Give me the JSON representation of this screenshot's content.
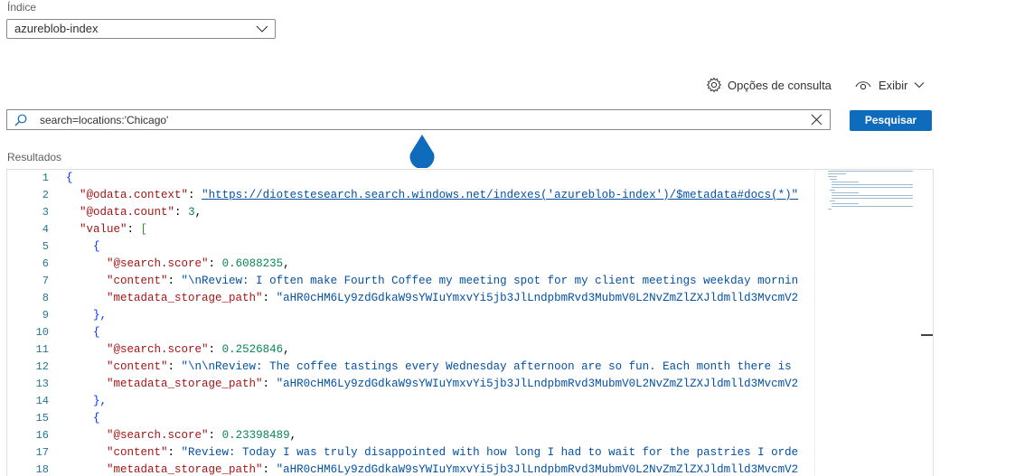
{
  "index": {
    "label": "Índice",
    "selected": "azureblob-index"
  },
  "toolbar": {
    "query_options_label": "Opções de consulta",
    "view_label": "Exibir"
  },
  "search": {
    "value": "search=locations:'Chicago'",
    "button_label": "Pesquisar"
  },
  "results": {
    "label": "Resultados",
    "line_numbers": [
      "1",
      "2",
      "3",
      "4",
      "5",
      "6",
      "7",
      "8",
      "9",
      "10",
      "11",
      "12",
      "13",
      "14",
      "15",
      "16",
      "17",
      "18"
    ],
    "lines": {
      "l1": "{",
      "l2_key": "\"@odata.context\"",
      "l2_val": "\"https://diotestesearch.search.windows.net/indexes('azureblob-index')/$metadata#docs(*)\"",
      "l3_key": "\"@odata.count\"",
      "l3_val": "3",
      "l4_key": "\"value\"",
      "l5": "{",
      "l6_key": "\"@search.score\"",
      "l6_val": "0.6088235",
      "l7_key": "\"content\"",
      "l7_val": "\"\\nReview: I often make Fourth Coffee my meeting spot for my client meetings weekday mornin",
      "l8_key": "\"metadata_storage_path\"",
      "l8_val": "\"aHR0cHM6Ly9zdGdkaW9sYWIuYmxvYi5jb3JlLndpbmRvd3MubmV0L2NvZmZlZXJldmlld3MvcmV2",
      "l9": "},",
      "l10": "{",
      "l11_key": "\"@search.score\"",
      "l11_val": "0.2526846",
      "l12_key": "\"content\"",
      "l12_val": "\"\\n\\nReview: The coffee tastings every Wednesday afternoon are so fun. Each month there is",
      "l13_key": "\"metadata_storage_path\"",
      "l13_val": "\"aHR0cHM6Ly9zdGdkaW9sYWIuYmxvYi5jb3JlLndpbmRvd3MubmV0L2NvZmZlZXJldmlld3MvcmV2",
      "l14": "},",
      "l15": "{",
      "l16_key": "\"@search.score\"",
      "l16_val": "0.23398489",
      "l17_key": "\"content\"",
      "l17_val": "\"Review: Today I was truly disappointed with how long I had to wait for the pastries I orde",
      "l18_key": "\"metadata_storage_path\"",
      "l18_val": "\"aHR0cHM6Ly9zdGdkaW9sYWIuYmxvYi5jb3JlLndpbmRvd3MubmV0L2NvZmZlZXJldmlld3MvcmV2"
    }
  },
  "colors": {
    "primary_button": "#0f6cbd",
    "json_key": "#a31515",
    "json_string": "#0451a5",
    "json_number": "#098658",
    "line_number": "#237893"
  }
}
